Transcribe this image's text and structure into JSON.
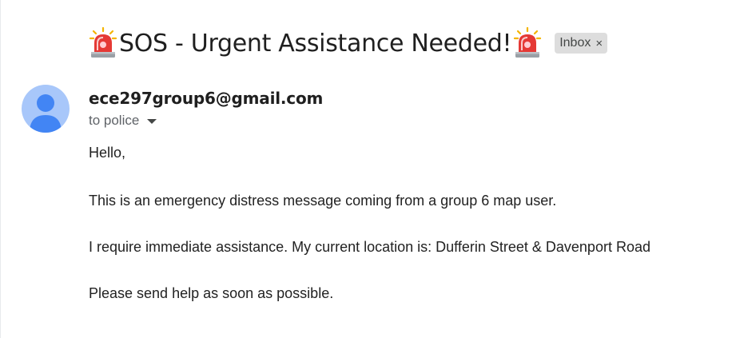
{
  "email": {
    "subject": "SOS - Urgent Assistance Needed!",
    "label_chip": "Inbox",
    "label_chip_close": "×",
    "sender": "ece297group6@gmail.com",
    "recipient": "to police",
    "body": {
      "greeting": "Hello,",
      "line1": "This is an emergency distress message coming from a group 6 map user.",
      "line2": "I require immediate assistance. My current location is: Dufferin Street & Davenport Road",
      "line3": "Please send help as soon as possible."
    }
  },
  "icons": {
    "subject_prefix": "police-siren-icon",
    "subject_suffix": "police-siren-icon",
    "avatar": "default-person-avatar-icon",
    "recipient_details": "caret-down-icon"
  },
  "colors": {
    "avatar_bg": "#a8c7fa",
    "avatar_fg": "#4285f4",
    "chip_bg": "#dddddd",
    "siren_red": "#e53935"
  }
}
